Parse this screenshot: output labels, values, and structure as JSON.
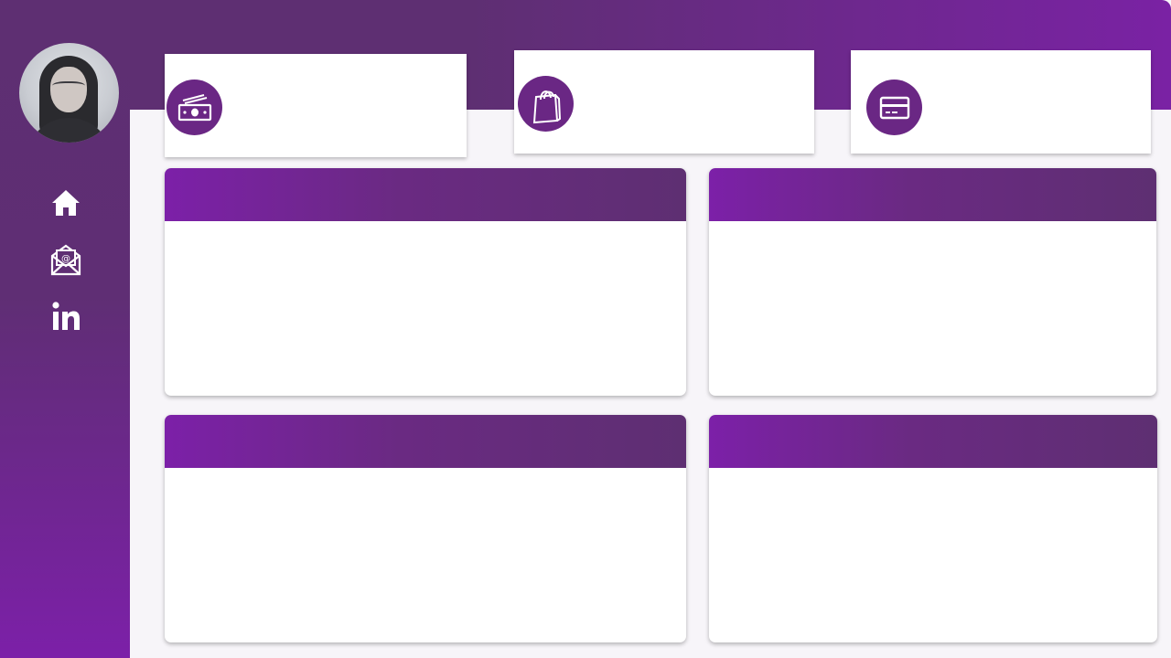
{
  "theme": {
    "primary": "#5e2f72",
    "accent": "#7c20a8",
    "background": "#f7f5f9",
    "card": "#ffffff"
  },
  "sidebar": {
    "avatar": "profile-photo",
    "nav": [
      {
        "icon": "home-icon"
      },
      {
        "icon": "mail-icon"
      },
      {
        "icon": "linkedin-icon"
      }
    ]
  },
  "kpi_cards": [
    {
      "icon": "cash-icon"
    },
    {
      "icon": "shopping-bag-icon"
    },
    {
      "icon": "credit-card-icon"
    }
  ],
  "panels": [
    {
      "title": ""
    },
    {
      "title": ""
    },
    {
      "title": ""
    },
    {
      "title": ""
    }
  ]
}
